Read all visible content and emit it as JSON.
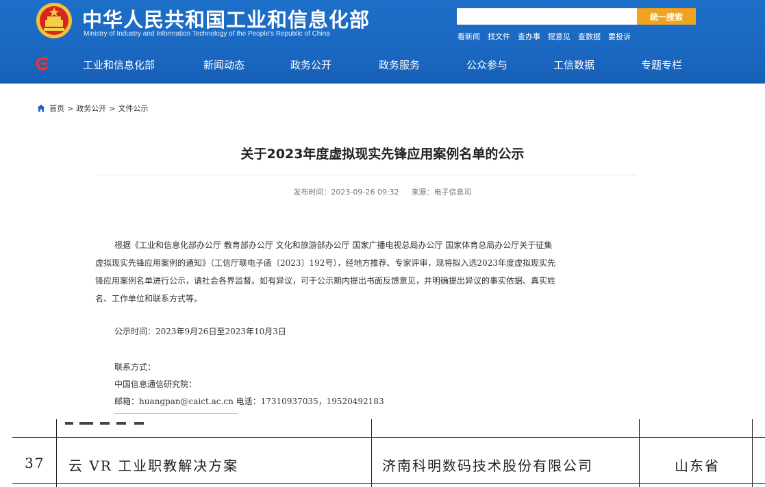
{
  "header": {
    "title_cn": "中华人民共和国工业和信息化部",
    "title_en": "Ministry of Industry and Information Technology of the People's Republic of China",
    "search_placeholder": "",
    "search_button": "统一搜索",
    "quick_links": [
      "看新闻",
      "找文件",
      "查办事",
      "提意见",
      "查数据",
      "要投诉"
    ],
    "nav": [
      "工业和信息化部",
      "新闻动态",
      "政务公开",
      "政务服务",
      "公众参与",
      "工信数据",
      "专题专栏"
    ]
  },
  "breadcrumb": [
    "首页",
    "政务公开",
    "文件公示"
  ],
  "breadcrumb_sep": ">",
  "article": {
    "title": "关于2023年度虚拟现实先锋应用案例名单的公示",
    "publish_label": "发布时间：",
    "publish_time": "2023-09-26 09:32",
    "source_label": "来源：",
    "source": "电子信息司",
    "para1_lines": [
      "根据《工业和信息化部办公厅 教育部办公厅 文化和旅游部办公厅 国家广播电视总局办公厅 国家体育总局办公厅关于征集",
      "虚拟现实先锋应用案例的通知》（工信厅联电子函〔2023〕192号），经地方推荐、专家评审，现将拟入选2023年度虚拟现实先",
      "锋应用案例名单进行公示，请社会各界监督。如有异议，可于公示期内提出书面反馈意见，并明确提出异议的事实依据、真实姓",
      "名、工作单位和联系方式等。"
    ],
    "notice_period": "公示时间：2023年9月26日至2023年10月3日",
    "contact_label": "联系方式：",
    "contact_org": "中国信息通信研究院：",
    "contact_line": "邮箱：huangpan@caict.ac.cn    电话：17310937035，19520492183"
  },
  "table": {
    "row": {
      "index": "37",
      "name": "云 VR 工业职教解决方案",
      "company": "济南科明数码技术股份有限公司",
      "province": "山东省"
    }
  },
  "colors": {
    "header_blue": "#1a66bf",
    "search_orange": "#f0a31e"
  }
}
